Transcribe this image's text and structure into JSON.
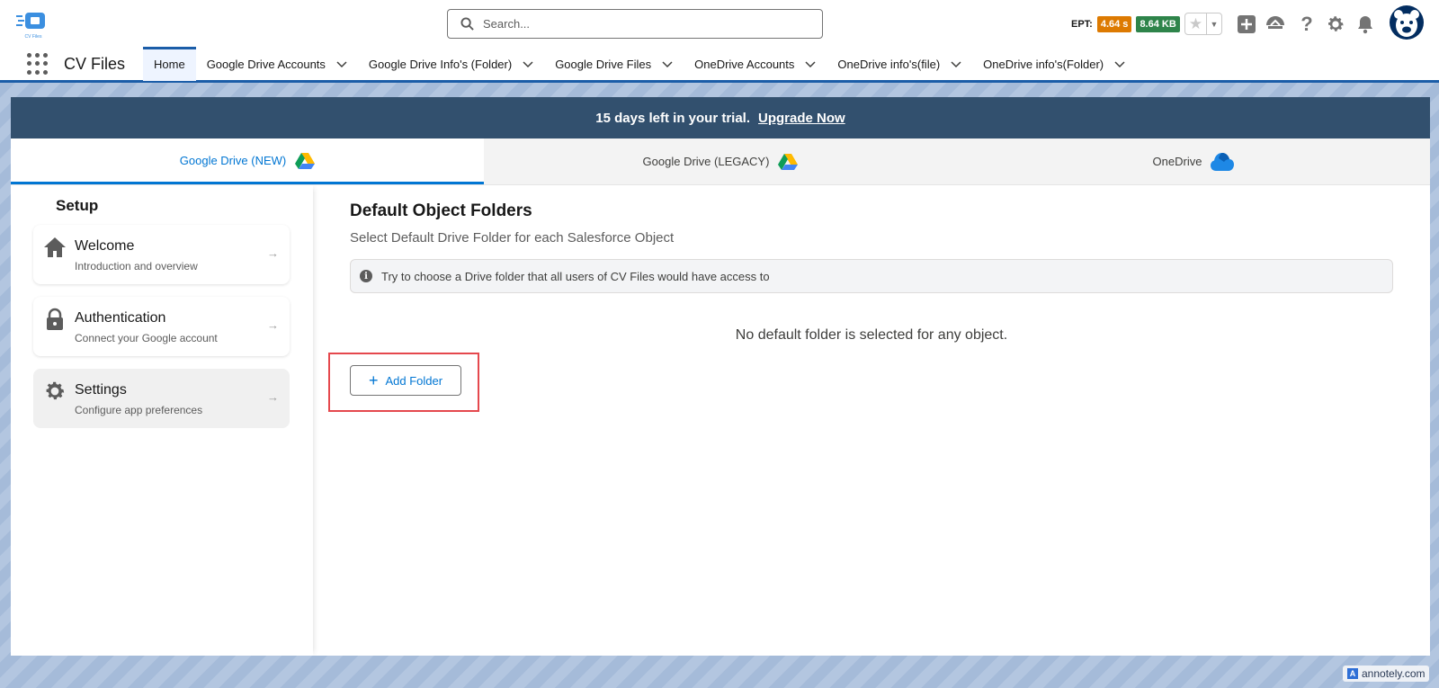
{
  "header": {
    "logo_text": "CV Files",
    "search_placeholder": "Search...",
    "ept_label": "EPT:",
    "ept_time": "4.64 s",
    "ept_size": "8.64 KB"
  },
  "appnav": {
    "app_name": "CV Files",
    "items": [
      {
        "label": "Home",
        "active": true
      },
      {
        "label": "Google Drive Accounts"
      },
      {
        "label": "Google Drive Info's (Folder)"
      },
      {
        "label": "Google Drive Files"
      },
      {
        "label": "OneDrive Accounts"
      },
      {
        "label": "OneDrive info's(file)"
      },
      {
        "label": "OneDrive info's(Folder)"
      }
    ]
  },
  "trial_banner": {
    "text": "15 days left in your trial.",
    "link": "Upgrade Now"
  },
  "tabs": [
    {
      "label": "Google Drive (NEW)",
      "icon": "google-drive-icon",
      "active": true
    },
    {
      "label": "Google Drive (LEGACY)",
      "icon": "google-drive-icon"
    },
    {
      "label": "OneDrive",
      "icon": "onedrive-icon"
    }
  ],
  "sidebar": {
    "title": "Setup",
    "items": [
      {
        "title": "Welcome",
        "subtitle": "Introduction and overview",
        "icon": "home-icon"
      },
      {
        "title": "Authentication",
        "subtitle": "Connect your Google account",
        "icon": "lock-icon"
      },
      {
        "title": "Settings",
        "subtitle": "Configure app preferences",
        "icon": "gear-icon",
        "active": true
      }
    ],
    "arrow": "→"
  },
  "main": {
    "title": "Default Object Folders",
    "subtitle": "Select Default Drive Folder for each Salesforce Object",
    "info": "Try to choose a Drive folder that all users of CV Files would have access to",
    "empty_message": "No default folder is selected for any object.",
    "add_button": "Add Folder"
  },
  "watermark": "annotely.com",
  "colors": {
    "accent": "#0176d3",
    "banner": "#32506e",
    "ept_time": "#dd7a01",
    "ept_size": "#2e844a",
    "annotation": "#e5484d"
  }
}
